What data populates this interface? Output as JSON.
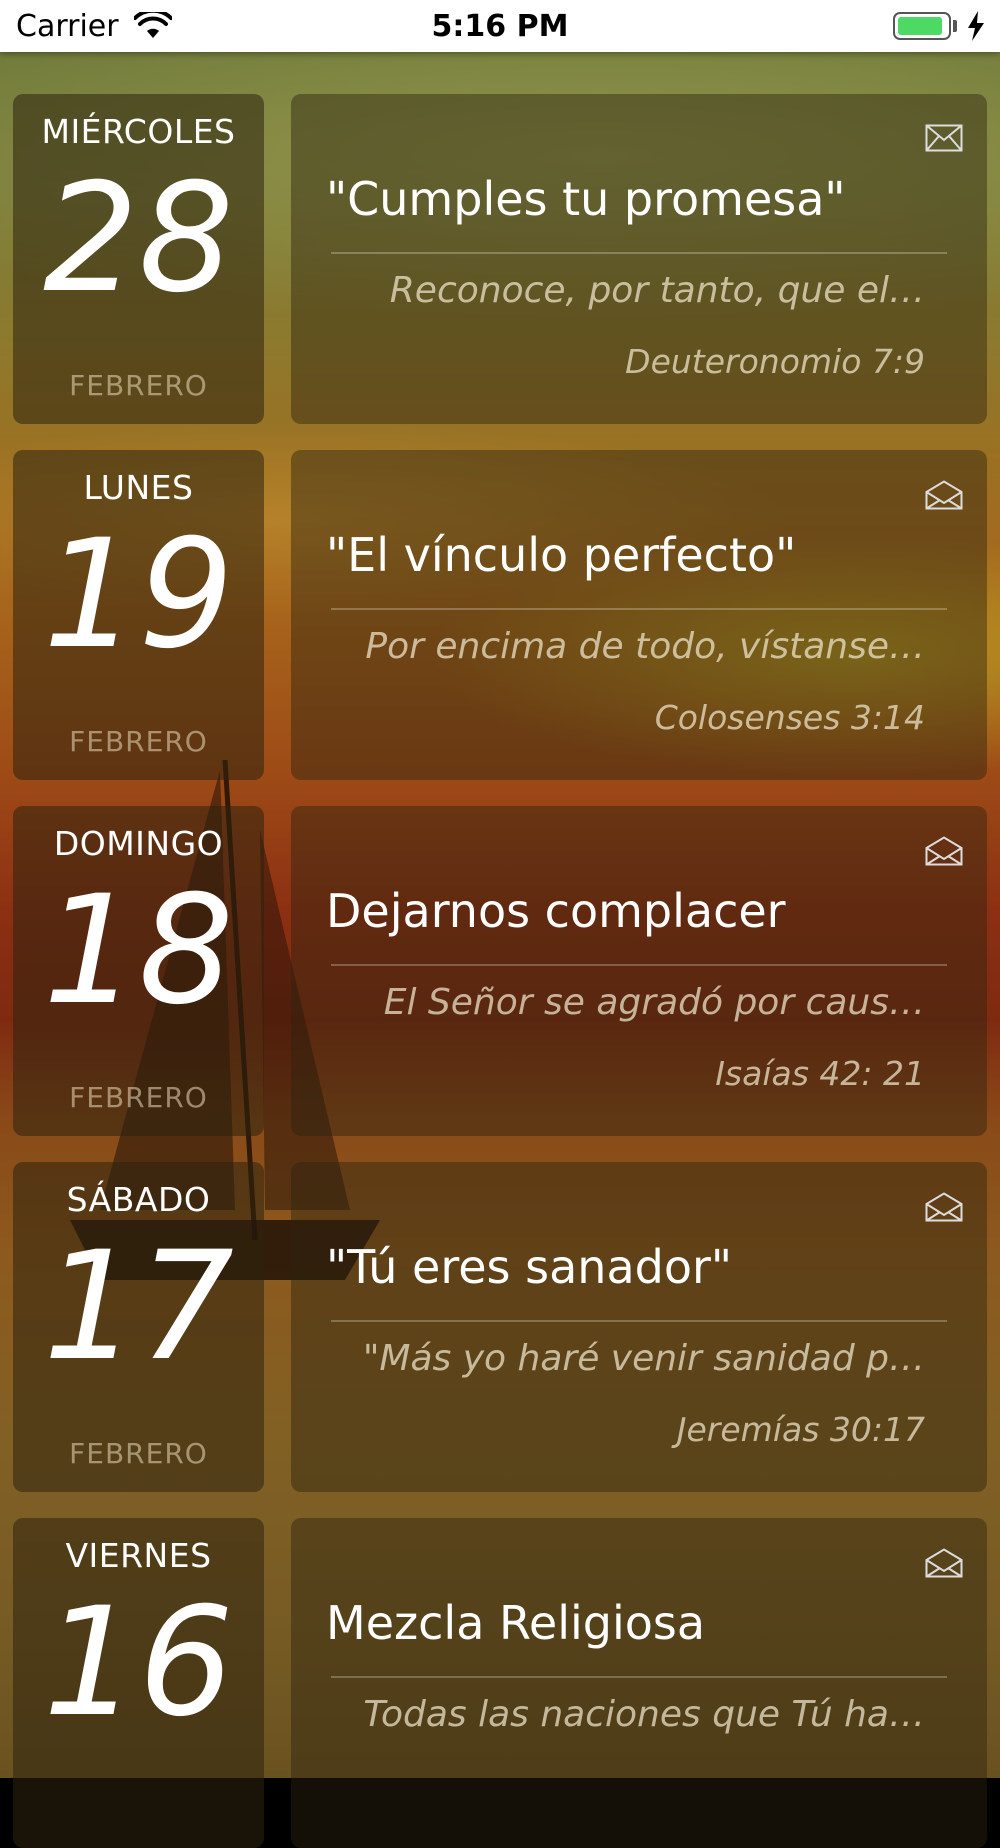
{
  "status_bar": {
    "carrier": "Carrier",
    "time": "5:16 PM",
    "battery_color": "#4cd964"
  },
  "entries": [
    {
      "weekday": "MIÉRCOLES",
      "day": "28",
      "month": "FEBRERO",
      "title": "\"Cumples tu promesa\"",
      "verse": "Reconoce, por tanto, que el…",
      "reference": "Deuteronomio 7:9",
      "icon": "envelope-closed-icon"
    },
    {
      "weekday": "LUNES",
      "day": "19",
      "month": "FEBRERO",
      "title": "\"El vínculo perfecto\"",
      "verse": "Por encima de todo, vístanse…",
      "reference": "Colosenses 3:14",
      "icon": "envelope-open-icon"
    },
    {
      "weekday": "DOMINGO",
      "day": "18",
      "month": "FEBRERO",
      "title": "Dejarnos complacer",
      "verse": "El Señor se agradó por caus…",
      "reference": "Isaías 42: 21",
      "icon": "envelope-open-icon"
    },
    {
      "weekday": "SÁBADO",
      "day": "17",
      "month": "FEBRERO",
      "title": "\"Tú eres sanador\"",
      "verse": "\"Más yo haré venir sanidad p…",
      "reference": "Jeremías 30:17",
      "icon": "envelope-open-icon"
    },
    {
      "weekday": "VIERNES",
      "day": "16",
      "month": "",
      "title": "Mezcla Religiosa",
      "verse": "Todas las naciones que Tú ha…",
      "reference": "",
      "icon": "envelope-open-icon"
    }
  ]
}
